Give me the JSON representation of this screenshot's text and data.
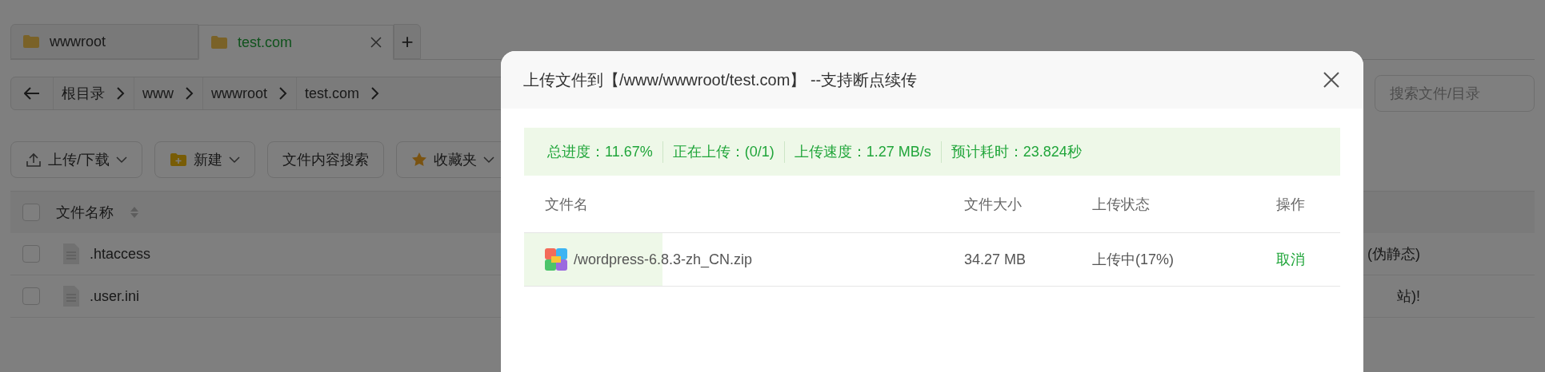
{
  "tabs": [
    {
      "label": "wwwroot",
      "selected": false,
      "closable": false
    },
    {
      "label": "test.com",
      "selected": true,
      "closable": true
    }
  ],
  "add_tab": "+",
  "breadcrumb": [
    "根目录",
    "www",
    "wwwroot",
    "test.com"
  ],
  "search": {
    "placeholder": "搜索文件/目录"
  },
  "toolbar": [
    {
      "label": "上传/下载",
      "dropdown": true
    },
    {
      "label": "新建",
      "dropdown": true
    },
    {
      "label": "文件内容搜索",
      "dropdown": false
    },
    {
      "label": "收藏夹",
      "dropdown": true
    }
  ],
  "file_table": {
    "columns": [
      "文件名称"
    ],
    "all_checked": false,
    "rows": [
      {
        "name": ".htaccess",
        "checked": false,
        "column_2": "(伪静态)"
      },
      {
        "name": ".user.ini",
        "checked": false,
        "column_2": "站)!"
      }
    ]
  },
  "dialog": {
    "title": "上传文件到【/www/wwwroot/test.com】 --支持断点续传",
    "summary": [
      "总进度：11.67%",
      "正在上传：(0/1)",
      "上传速度：1.27 MB/s",
      "预计耗时：23.824秒"
    ],
    "columns": [
      "文件名",
      "文件大小",
      "上传状态",
      "操作"
    ],
    "rows": [
      {
        "name": "/wordpress-6.8.3-zh_CN.zip",
        "size": "34.27 MB",
        "status": "上传中(17%)",
        "action": "取消",
        "level": 0.17
      }
    ]
  }
}
